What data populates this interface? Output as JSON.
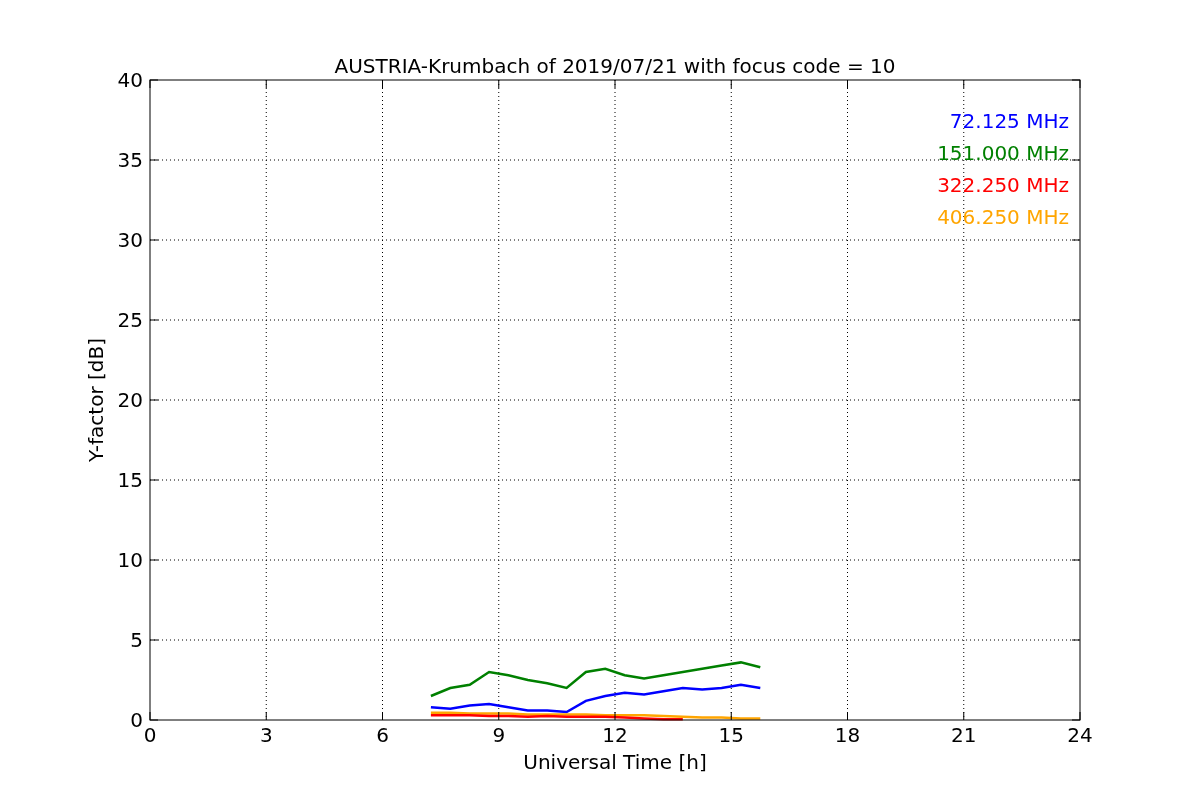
{
  "chart_data": {
    "type": "line",
    "title": "AUSTRIA-Krumbach of 2019/07/21 with focus code = 10",
    "xlabel": "Universal Time [h]",
    "ylabel": "Y-factor [dB]",
    "x": [
      7.25,
      7.75,
      8.25,
      8.75,
      9.25,
      9.75,
      10.25,
      10.75,
      11.25,
      11.75,
      12.25,
      12.75,
      13.25,
      13.75,
      14.25,
      14.75,
      15.25,
      15.75
    ],
    "series": [
      {
        "name": "72.125 MHz",
        "color": "#0000ff",
        "values": [
          0.8,
          0.7,
          0.9,
          1.0,
          0.8,
          0.6,
          0.6,
          0.5,
          1.2,
          1.5,
          1.7,
          1.6,
          1.8,
          2.0,
          1.9,
          2.0,
          2.2,
          2.0
        ]
      },
      {
        "name": "151.000 MHz",
        "color": "#008000",
        "values": [
          1.5,
          2.0,
          2.2,
          3.0,
          2.8,
          2.5,
          2.3,
          2.0,
          3.0,
          3.2,
          2.8,
          2.6,
          2.8,
          3.0,
          3.2,
          3.4,
          3.6,
          3.3
        ]
      },
      {
        "name": "322.250 MHz",
        "color": "#ff0000",
        "values": [
          0.3,
          0.3,
          0.3,
          0.25,
          0.25,
          0.2,
          0.25,
          0.2,
          0.2,
          0.2,
          0.15,
          0.1,
          0.05,
          0.05,
          null,
          null,
          null,
          null
        ]
      },
      {
        "name": "406.250 MHz",
        "color": "#ffa500",
        "values": [
          0.45,
          0.45,
          0.4,
          0.4,
          0.4,
          0.35,
          0.35,
          0.35,
          0.35,
          0.3,
          0.3,
          0.3,
          0.25,
          0.2,
          0.15,
          0.15,
          0.1,
          0.1
        ]
      }
    ],
    "grid": true,
    "xlim": [
      0,
      24
    ],
    "ylim": [
      0,
      40
    ],
    "xticks": [
      0,
      3,
      6,
      9,
      12,
      15,
      18,
      21,
      24
    ],
    "yticks": [
      0,
      5,
      10,
      15,
      20,
      25,
      30,
      35,
      40
    ]
  }
}
